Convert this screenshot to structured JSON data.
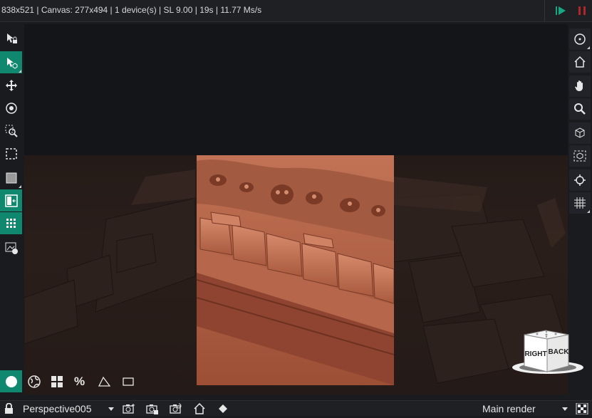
{
  "topbar": {
    "stats": "838x521 | Canvas: 277x494 | 1 device(s) | SL 9.00 | 19s | 11.77 Ms/s",
    "play_icon": "play-icon",
    "pause_icon": "pause-icon",
    "play_color": "#19a783",
    "pause_color": "#b0272b"
  },
  "left_toolbar": {
    "tools": [
      {
        "icon": "select-lock-icon",
        "active": false
      },
      {
        "icon": "select-object-icon",
        "active": true
      },
      {
        "icon": "move-icon",
        "active": false
      },
      {
        "icon": "pick-focus-icon",
        "active": false
      },
      {
        "icon": "zoom-region-icon",
        "active": false
      },
      {
        "icon": "region-render-icon",
        "active": false
      },
      {
        "icon": "background-icon",
        "active": false
      },
      {
        "icon": "split-view-icon",
        "active": true
      },
      {
        "icon": "grid-view-icon",
        "active": true
      },
      {
        "icon": "snapshot-icon",
        "active": false
      }
    ]
  },
  "right_toolbar": {
    "tools": [
      "orbit-icon",
      "home-icon",
      "pan-icon",
      "zoom-icon",
      "view-cube-icon",
      "frame-icon",
      "target-icon",
      "grid-icon"
    ]
  },
  "bottom_toolbar": {
    "buttons": [
      {
        "icon": "sphere-icon",
        "label": "",
        "active": true
      },
      {
        "icon": "globe-icon",
        "label": "",
        "active": false
      },
      {
        "icon": "tiles-icon",
        "label": "",
        "active": false
      },
      {
        "icon": "aspect-icon",
        "label": "%",
        "active": false
      },
      {
        "icon": "perspective-icon",
        "label": "",
        "active": false
      },
      {
        "icon": "frame-rect-icon",
        "label": "",
        "active": false
      }
    ]
  },
  "status_bar": {
    "camera": "Perspective005",
    "render_target": "Main render",
    "icons": [
      "lock-icon",
      "camera-add-icon",
      "camera-save-icon",
      "camera-reset-icon",
      "home-icon",
      "diamond-icon",
      "checker-icon"
    ]
  },
  "nav_cube": {
    "right_label": "RIGHT",
    "back_label": "BACK"
  },
  "colors": {
    "accent": "#10876f",
    "background": "#1a1b1f",
    "render_tint": "#b9684d"
  }
}
